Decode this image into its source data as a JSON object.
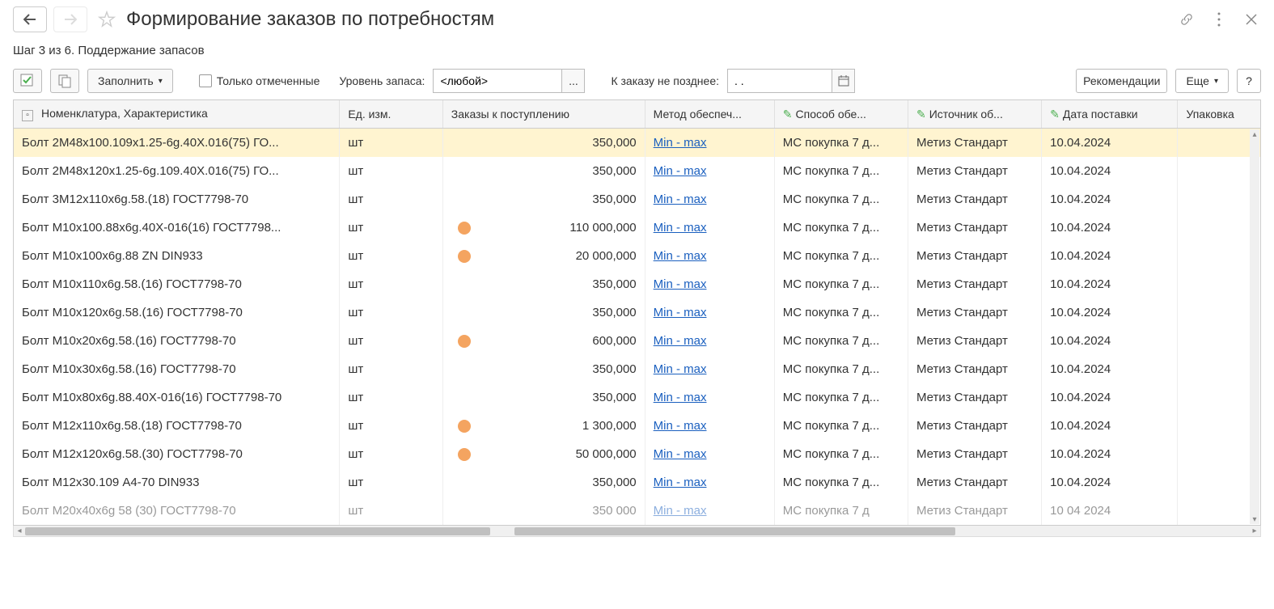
{
  "title": "Формирование заказов по потребностям",
  "step": "Шаг 3 из 6. Поддержание запасов",
  "toolbar": {
    "fill": "Заполнить",
    "only_checked": "Только отмеченные",
    "stock_level_label": "Уровень запаса:",
    "stock_level_value": "<любой>",
    "order_no_later": "К заказу не позднее:",
    "date_value": ". .",
    "recommendations": "Рекомендации",
    "more": "Еще",
    "help": "?"
  },
  "columns": {
    "c0": "Номенклатура, Характеристика",
    "c1": "Ед. изм.",
    "c2": "Заказы к поступлению",
    "c3": "Метод обеспеч...",
    "c4": "Способ обе...",
    "c5": "Источник об...",
    "c6": "Дата поставки",
    "c7": "Упаковка"
  },
  "rows": [
    {
      "name": "Болт 2М48х100.109х1.25-6g.40Х.016(75) ГО...",
      "unit": "шт",
      "dot": false,
      "qty": "350,000",
      "method": "Min - max",
      "supply": "МС покупка 7 д...",
      "source": "Метиз Стандарт",
      "date": "10.04.2024",
      "pack": ""
    },
    {
      "name": "Болт 2М48х120х1.25-6g.109.40Х.016(75) ГО...",
      "unit": "шт",
      "dot": false,
      "qty": "350,000",
      "method": "Min - max",
      "supply": "МС покупка 7 д...",
      "source": "Метиз Стандарт",
      "date": "10.04.2024",
      "pack": ""
    },
    {
      "name": "Болт 3М12х110х6g.58.(18) ГОСТ7798-70",
      "unit": "шт",
      "dot": false,
      "qty": "350,000",
      "method": "Min - max",
      "supply": "МС покупка 7 д...",
      "source": "Метиз Стандарт",
      "date": "10.04.2024",
      "pack": ""
    },
    {
      "name": "Болт М10х100.88х6g.40Х-016(16) ГОСТ7798...",
      "unit": "шт",
      "dot": true,
      "qty": "110 000,000",
      "method": "Min - max",
      "supply": "МС покупка 7 д...",
      "source": "Метиз Стандарт",
      "date": "10.04.2024",
      "pack": ""
    },
    {
      "name": "Болт М10х100х6g.88 ZN DIN933",
      "unit": "шт",
      "dot": true,
      "qty": "20 000,000",
      "method": "Min - max",
      "supply": "МС покупка 7 д...",
      "source": "Метиз Стандарт",
      "date": "10.04.2024",
      "pack": ""
    },
    {
      "name": "Болт М10х110х6g.58.(16) ГОСТ7798-70",
      "unit": "шт",
      "dot": false,
      "qty": "350,000",
      "method": "Min - max",
      "supply": "МС покупка 7 д...",
      "source": "Метиз Стандарт",
      "date": "10.04.2024",
      "pack": ""
    },
    {
      "name": "Болт М10х120х6g.58.(16) ГОСТ7798-70",
      "unit": "шт",
      "dot": false,
      "qty": "350,000",
      "method": "Min - max",
      "supply": "МС покупка 7 д...",
      "source": "Метиз Стандарт",
      "date": "10.04.2024",
      "pack": ""
    },
    {
      "name": "Болт М10х20х6g.58.(16) ГОСТ7798-70",
      "unit": "шт",
      "dot": true,
      "qty": "600,000",
      "method": "Min - max",
      "supply": "МС покупка 7 д...",
      "source": "Метиз Стандарт",
      "date": "10.04.2024",
      "pack": ""
    },
    {
      "name": "Болт М10х30х6g.58.(16) ГОСТ7798-70",
      "unit": "шт",
      "dot": false,
      "qty": "350,000",
      "method": "Min - max",
      "supply": "МС покупка 7 д...",
      "source": "Метиз Стандарт",
      "date": "10.04.2024",
      "pack": ""
    },
    {
      "name": "Болт М10х80х6g.88.40Х-016(16) ГОСТ7798-70",
      "unit": "шт",
      "dot": false,
      "qty": "350,000",
      "method": "Min - max",
      "supply": "МС покупка 7 д...",
      "source": "Метиз Стандарт",
      "date": "10.04.2024",
      "pack": ""
    },
    {
      "name": "Болт М12х110х6g.58.(18) ГОСТ7798-70",
      "unit": "шт",
      "dot": true,
      "qty": "1 300,000",
      "method": "Min - max",
      "supply": "МС покупка 7 д...",
      "source": "Метиз Стандарт",
      "date": "10.04.2024",
      "pack": ""
    },
    {
      "name": "Болт М12х120х6g.58.(30) ГОСТ7798-70",
      "unit": "шт",
      "dot": true,
      "qty": "50 000,000",
      "method": "Min - max",
      "supply": "МС покупка 7 д...",
      "source": "Метиз Стандарт",
      "date": "10.04.2024",
      "pack": ""
    },
    {
      "name": "Болт М12х30.109 А4-70 DIN933",
      "unit": "шт",
      "dot": false,
      "qty": "350,000",
      "method": "Min - max",
      "supply": "МС покупка 7 д...",
      "source": "Метиз Стандарт",
      "date": "10.04.2024",
      "pack": ""
    },
    {
      "name": "Болт М20х40х6g 58 (30) ГОСТ7798-70",
      "unit": "шт",
      "dot": false,
      "qty": "350 000",
      "method": "Min - max",
      "supply": "МС покупка 7 д",
      "source": "Метиз Стандарт",
      "date": "10 04 2024",
      "pack": ""
    }
  ]
}
